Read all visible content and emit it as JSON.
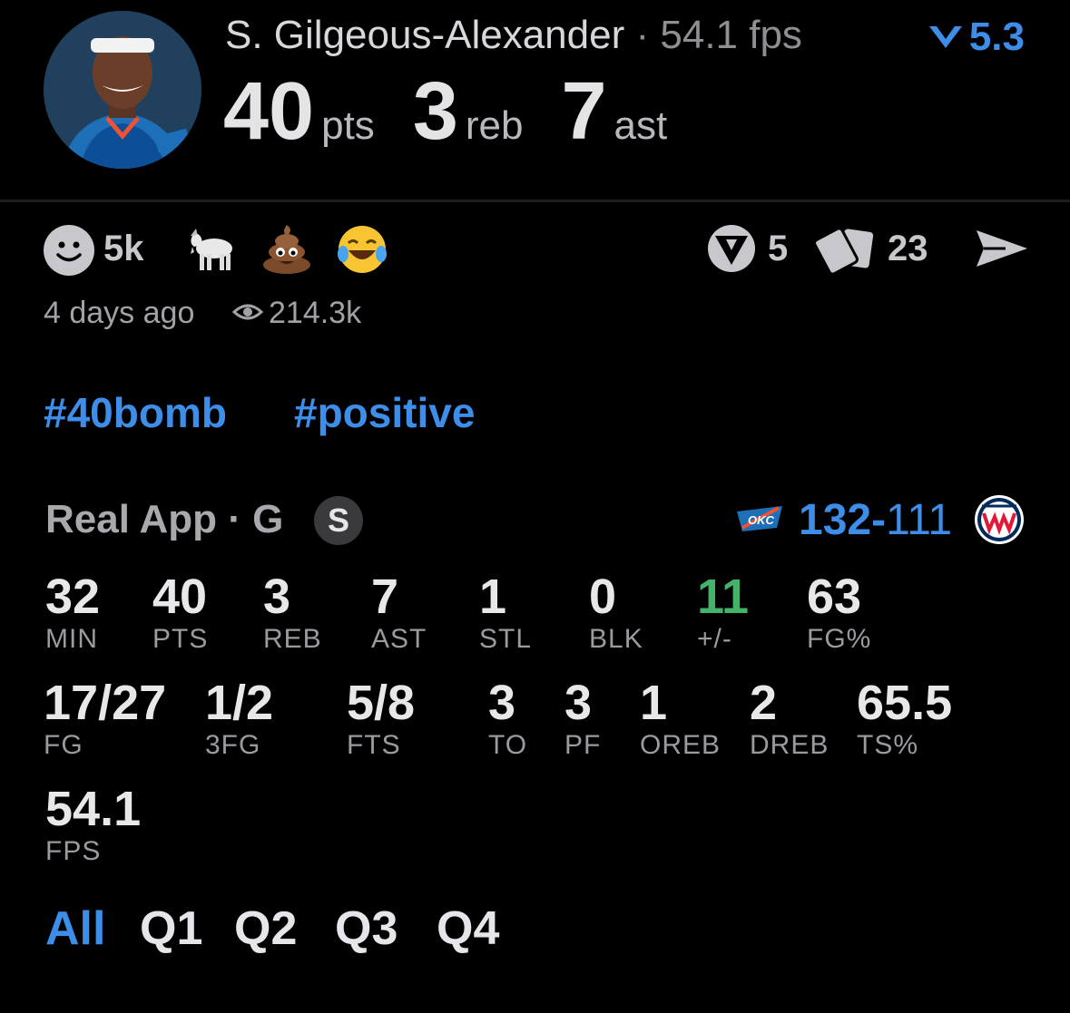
{
  "header": {
    "player_name": "S. Gilgeous-Alexander",
    "separator": "·",
    "fps": "54.1 fps",
    "rating": "5.3",
    "pts": "40",
    "pts_label": "pts",
    "reb": "3",
    "reb_label": "reb",
    "ast": "7",
    "ast_label": "ast"
  },
  "reactions": {
    "count": "5k",
    "icons": [
      "smiley-icon",
      "goat-icon",
      "poop-icon",
      "laughing-icon"
    ],
    "votes": "5",
    "cards": "23"
  },
  "meta": {
    "time_ago": "4 days ago",
    "views": "214.3k"
  },
  "tags": [
    "#40bomb",
    "#positive"
  ],
  "game": {
    "label": "Real App · G",
    "badge": "S",
    "score_home": "132",
    "score_dash": "-",
    "score_away": "111",
    "home_color": "#3d8ee8"
  },
  "stats_row1": [
    {
      "v": "32",
      "k": "MIN"
    },
    {
      "v": "40",
      "k": "PTS"
    },
    {
      "v": "3",
      "k": "REB"
    },
    {
      "v": "7",
      "k": "AST"
    },
    {
      "v": "1",
      "k": "STL"
    },
    {
      "v": "0",
      "k": "BLK"
    },
    {
      "v": "11",
      "k": "+/-"
    },
    {
      "v": "63",
      "k": "FG%"
    }
  ],
  "stats_row2": [
    {
      "v": "17/27",
      "k": "FG"
    },
    {
      "v": "1/2",
      "k": "3FG"
    },
    {
      "v": "5/8",
      "k": "FTS"
    },
    {
      "v": "3",
      "k": "TO"
    },
    {
      "v": "3",
      "k": "PF"
    },
    {
      "v": "1",
      "k": "OREB"
    },
    {
      "v": "2",
      "k": "DREB"
    },
    {
      "v": "65.5",
      "k": "TS%"
    }
  ],
  "stats_row3": [
    {
      "v": "54.1",
      "k": "FPS"
    }
  ],
  "tabs": [
    "All",
    "Q1",
    "Q2",
    "Q3",
    "Q4"
  ],
  "colors": {
    "accent": "#3d8ee8",
    "positive": "#44b36a",
    "background": "#000000"
  }
}
